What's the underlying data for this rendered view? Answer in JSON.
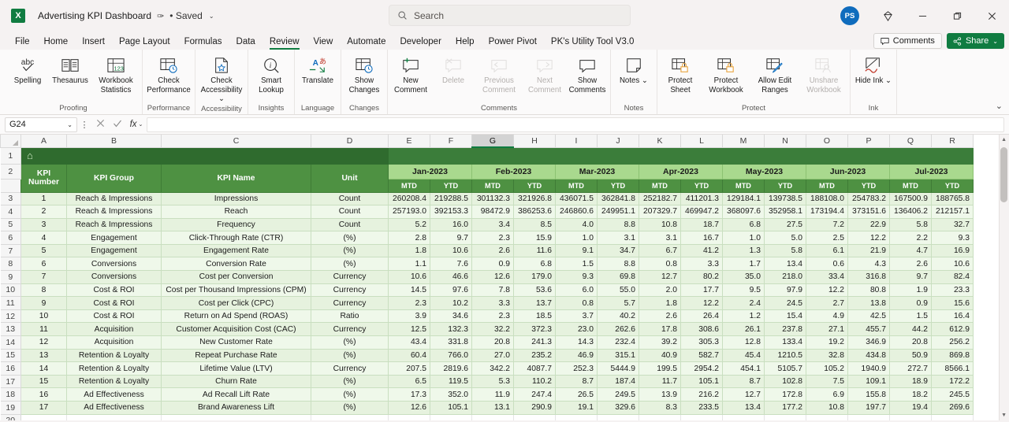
{
  "titlebar": {
    "app_logo": "excel-logo",
    "file_name": "Advertising KPI Dashboard",
    "autosave_pen": "✑",
    "saved_status": "• Saved",
    "chevron": "⌄",
    "search_placeholder": "Search",
    "avatar_initials": "PS",
    "diamond_icon": "◈",
    "minimize": "—",
    "restore": "❐",
    "close": "✕"
  },
  "tabs": [
    {
      "label": "File",
      "active": false
    },
    {
      "label": "Home",
      "active": false
    },
    {
      "label": "Insert",
      "active": false
    },
    {
      "label": "Page Layout",
      "active": false
    },
    {
      "label": "Formulas",
      "active": false
    },
    {
      "label": "Data",
      "active": false
    },
    {
      "label": "Review",
      "active": true
    },
    {
      "label": "View",
      "active": false
    },
    {
      "label": "Automate",
      "active": false
    },
    {
      "label": "Developer",
      "active": false
    },
    {
      "label": "Help",
      "active": false
    },
    {
      "label": "Power Pivot",
      "active": false
    },
    {
      "label": "PK's Utility Tool V3.0",
      "active": false
    }
  ],
  "tab_actions": {
    "comments_label": "Comments",
    "share_label": "Share",
    "share_chevron": "⌄"
  },
  "ribbon": {
    "collapse_chevron": "⌄",
    "groups": [
      {
        "label": "Proofing",
        "buttons": [
          {
            "name": "spelling",
            "label": "Spelling",
            "icon": "abc-check-icon",
            "disabled": false
          },
          {
            "name": "thesaurus",
            "label": "Thesaurus",
            "icon": "book-icon",
            "disabled": false
          },
          {
            "name": "workbook-statistics",
            "label": "Workbook Statistics",
            "icon": "grid-123-icon",
            "disabled": false
          }
        ]
      },
      {
        "label": "Performance",
        "buttons": [
          {
            "name": "check-performance",
            "label": "Check Performance",
            "icon": "grid-clock-icon",
            "disabled": false
          }
        ]
      },
      {
        "label": "Accessibility",
        "buttons": [
          {
            "name": "check-accessibility",
            "label": "Check Accessibility ⌄",
            "icon": "page-person-icon",
            "disabled": false
          }
        ]
      },
      {
        "label": "Insights",
        "buttons": [
          {
            "name": "smart-lookup",
            "label": "Smart Lookup",
            "icon": "magnifier-info-icon",
            "disabled": false
          }
        ]
      },
      {
        "label": "Language",
        "buttons": [
          {
            "name": "translate",
            "label": "Translate",
            "icon": "translate-icon",
            "disabled": false
          }
        ]
      },
      {
        "label": "Changes",
        "buttons": [
          {
            "name": "show-changes",
            "label": "Show Changes",
            "icon": "grid-clock-icon",
            "disabled": false
          }
        ]
      },
      {
        "label": "Comments",
        "buttons": [
          {
            "name": "new-comment",
            "label": "New Comment",
            "icon": "comment-plus-icon",
            "disabled": false
          },
          {
            "name": "delete-comment",
            "label": "Delete",
            "icon": "comment-x-icon",
            "disabled": true
          },
          {
            "name": "previous-comment",
            "label": "Previous Comment",
            "icon": "comment-left-icon",
            "disabled": true
          },
          {
            "name": "next-comment",
            "label": "Next Comment",
            "icon": "comment-right-icon",
            "disabled": true
          },
          {
            "name": "show-comments",
            "label": "Show Comments",
            "icon": "comment-icon",
            "disabled": false
          }
        ]
      },
      {
        "label": "Notes",
        "buttons": [
          {
            "name": "notes",
            "label": "Notes ⌄",
            "icon": "note-icon",
            "disabled": false
          }
        ]
      },
      {
        "label": "Protect",
        "buttons": [
          {
            "name": "protect-sheet",
            "label": "Protect Sheet",
            "icon": "grid-lock-icon",
            "disabled": false
          },
          {
            "name": "protect-workbook",
            "label": "Protect Workbook",
            "icon": "grid-lock-icon",
            "disabled": false
          },
          {
            "name": "allow-edit-ranges",
            "label": "Allow Edit Ranges",
            "icon": "grid-pencil-icon",
            "disabled": false
          },
          {
            "name": "unshare-workbook",
            "label": "Unshare Workbook",
            "icon": "grid-person-icon",
            "disabled": true
          }
        ]
      },
      {
        "label": "Ink",
        "buttons": [
          {
            "name": "hide-ink",
            "label": "Hide Ink ⌄",
            "icon": "ink-icon",
            "disabled": false
          }
        ]
      }
    ]
  },
  "formula_bar": {
    "name_box": "G24",
    "name_chevron": "⌄",
    "menu_dots": "⋮",
    "cancel_icon": "✕",
    "enter_icon": "✓",
    "fx_icon": "fx",
    "fx_chevron": "⌄",
    "formula_value": ""
  },
  "grid": {
    "columns": [
      "A",
      "B",
      "C",
      "D",
      "E",
      "F",
      "G",
      "H",
      "I",
      "J",
      "K",
      "L",
      "M",
      "N",
      "O",
      "P",
      "Q",
      "R"
    ],
    "selected_column": "G",
    "row_numbers": [
      "1",
      "2",
      "3",
      "4",
      "5",
      "6",
      "7",
      "8",
      "9",
      "10",
      "11",
      "12",
      "13",
      "14",
      "15",
      "16",
      "17",
      "18",
      "19",
      "20"
    ],
    "banner_home_icon": "⌂",
    "left_headers": [
      "KPI Number",
      "KPI Group",
      "KPI Name",
      "Unit"
    ],
    "months": [
      "Jan-2023",
      "Feb-2023",
      "Mar-2023",
      "Apr-2023",
      "May-2023",
      "Jun-2023",
      "Jul-2023"
    ],
    "sub_headers": [
      "MTD",
      "YTD"
    ],
    "rows": [
      {
        "num": "1",
        "group": "Reach & Impressions",
        "name": "Impressions",
        "unit": "Count",
        "values": [
          "260208.4",
          "219288.5",
          "301132.3",
          "321926.8",
          "436071.5",
          "362841.8",
          "252182.7",
          "411201.3",
          "129184.1",
          "139738.5",
          "188108.0",
          "254783.2",
          "167500.9",
          "188765.8"
        ]
      },
      {
        "num": "2",
        "group": "Reach & Impressions",
        "name": "Reach",
        "unit": "Count",
        "values": [
          "257193.0",
          "392153.3",
          "98472.9",
          "386253.6",
          "246860.6",
          "249951.1",
          "207329.7",
          "469947.2",
          "368097.6",
          "352958.1",
          "173194.4",
          "373151.6",
          "136406.2",
          "212157.1"
        ]
      },
      {
        "num": "3",
        "group": "Reach & Impressions",
        "name": "Frequency",
        "unit": "Count",
        "values": [
          "5.2",
          "16.0",
          "3.4",
          "8.5",
          "4.0",
          "8.8",
          "10.8",
          "18.7",
          "6.8",
          "27.5",
          "7.2",
          "22.9",
          "5.8",
          "32.7"
        ]
      },
      {
        "num": "4",
        "group": "Engagement",
        "name": "Click-Through Rate (CTR)",
        "unit": "(%)",
        "values": [
          "2.8",
          "9.7",
          "2.3",
          "15.9",
          "1.0",
          "3.1",
          "3.1",
          "16.7",
          "1.0",
          "5.0",
          "2.5",
          "12.2",
          "2.2",
          "9.3"
        ]
      },
      {
        "num": "5",
        "group": "Engagement",
        "name": "Engagement Rate",
        "unit": "(%)",
        "values": [
          "1.8",
          "10.6",
          "2.6",
          "11.6",
          "9.1",
          "34.7",
          "6.7",
          "41.2",
          "1.3",
          "5.8",
          "6.1",
          "21.9",
          "4.7",
          "16.9"
        ]
      },
      {
        "num": "6",
        "group": "Conversions",
        "name": "Conversion Rate",
        "unit": "(%)",
        "values": [
          "1.1",
          "7.6",
          "0.9",
          "6.8",
          "1.5",
          "8.8",
          "0.8",
          "3.3",
          "1.7",
          "13.4",
          "0.6",
          "4.3",
          "2.6",
          "10.6"
        ]
      },
      {
        "num": "7",
        "group": "Conversions",
        "name": "Cost per Conversion",
        "unit": "Currency",
        "values": [
          "10.6",
          "46.6",
          "12.6",
          "179.0",
          "9.3",
          "69.8",
          "12.7",
          "80.2",
          "35.0",
          "218.0",
          "33.4",
          "316.8",
          "9.7",
          "82.4"
        ]
      },
      {
        "num": "8",
        "group": "Cost & ROI",
        "name": "Cost per Thousand Impressions (CPM)",
        "unit": "Currency",
        "values": [
          "14.5",
          "97.6",
          "7.8",
          "53.6",
          "6.0",
          "55.0",
          "2.0",
          "17.7",
          "9.5",
          "97.9",
          "12.2",
          "80.8",
          "1.9",
          "23.3"
        ]
      },
      {
        "num": "9",
        "group": "Cost & ROI",
        "name": "Cost per Click (CPC)",
        "unit": "Currency",
        "values": [
          "2.3",
          "10.2",
          "3.3",
          "13.7",
          "0.8",
          "5.7",
          "1.8",
          "12.2",
          "2.4",
          "24.5",
          "2.7",
          "13.8",
          "0.9",
          "15.6"
        ]
      },
      {
        "num": "10",
        "group": "Cost & ROI",
        "name": "Return on Ad Spend (ROAS)",
        "unit": "Ratio",
        "values": [
          "3.9",
          "34.6",
          "2.3",
          "18.5",
          "3.7",
          "40.2",
          "2.6",
          "26.4",
          "1.2",
          "15.4",
          "4.9",
          "42.5",
          "1.5",
          "16.4"
        ]
      },
      {
        "num": "11",
        "group": "Acquisition",
        "name": "Customer Acquisition Cost (CAC)",
        "unit": "Currency",
        "values": [
          "12.5",
          "132.3",
          "32.2",
          "372.3",
          "23.0",
          "262.6",
          "17.8",
          "308.6",
          "26.1",
          "237.8",
          "27.1",
          "455.7",
          "44.2",
          "612.9"
        ]
      },
      {
        "num": "12",
        "group": "Acquisition",
        "name": "New Customer Rate",
        "unit": "(%)",
        "values": [
          "43.4",
          "331.8",
          "20.8",
          "241.3",
          "14.3",
          "232.4",
          "39.2",
          "305.3",
          "12.8",
          "133.4",
          "19.2",
          "346.9",
          "20.8",
          "256.2"
        ]
      },
      {
        "num": "13",
        "group": "Retention & Loyalty",
        "name": "Repeat Purchase Rate",
        "unit": "(%)",
        "values": [
          "60.4",
          "766.0",
          "27.0",
          "235.2",
          "46.9",
          "315.1",
          "40.9",
          "582.7",
          "45.4",
          "1210.5",
          "32.8",
          "434.8",
          "50.9",
          "869.8"
        ]
      },
      {
        "num": "14",
        "group": "Retention & Loyalty",
        "name": "Lifetime Value (LTV)",
        "unit": "Currency",
        "values": [
          "207.5",
          "2819.6",
          "342.2",
          "4087.7",
          "252.3",
          "5444.9",
          "199.5",
          "2954.2",
          "454.1",
          "5105.7",
          "105.2",
          "1940.9",
          "272.7",
          "8566.1"
        ]
      },
      {
        "num": "15",
        "group": "Retention & Loyalty",
        "name": "Churn Rate",
        "unit": "(%)",
        "values": [
          "6.5",
          "119.5",
          "5.3",
          "110.2",
          "8.7",
          "187.4",
          "11.7",
          "105.1",
          "8.7",
          "102.8",
          "7.5",
          "109.1",
          "18.9",
          "172.2"
        ]
      },
      {
        "num": "16",
        "group": "Ad Effectiveness",
        "name": "Ad Recall Lift Rate",
        "unit": "(%)",
        "values": [
          "17.3",
          "352.0",
          "11.9",
          "247.4",
          "26.5",
          "249.5",
          "13.9",
          "216.2",
          "12.7",
          "172.8",
          "6.9",
          "155.8",
          "18.2",
          "245.5"
        ]
      },
      {
        "num": "17",
        "group": "Ad Effectiveness",
        "name": "Brand Awareness Lift",
        "unit": "(%)",
        "values": [
          "12.6",
          "105.1",
          "13.1",
          "290.9",
          "19.1",
          "329.6",
          "8.3",
          "233.5",
          "13.4",
          "177.2",
          "10.8",
          "197.7",
          "19.4",
          "269.6"
        ]
      }
    ]
  },
  "colors": {
    "excel_green": "#107c41",
    "header_green": "#4e9142",
    "month_green": "#a9d98e",
    "band_green": "#3b7d3a",
    "row_green": "#e6f2de",
    "row_green_alt": "#eff8ea"
  }
}
